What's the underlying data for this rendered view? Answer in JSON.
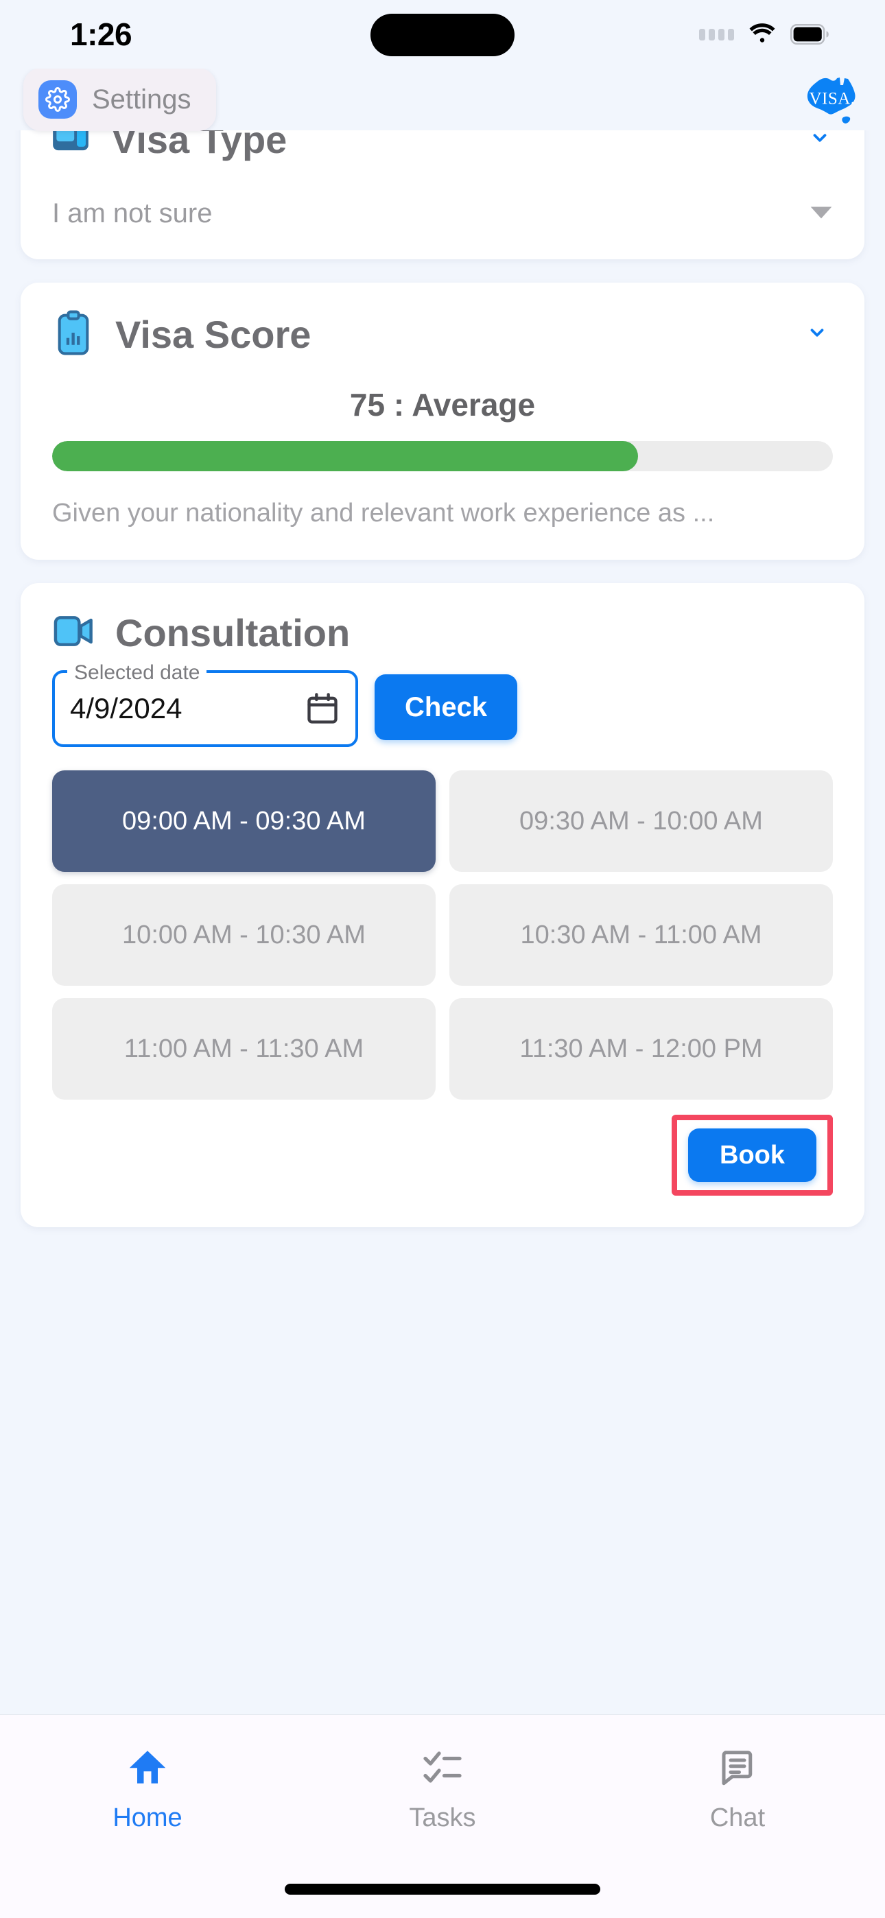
{
  "status_bar": {
    "time": "1:26",
    "icons": [
      "signal-dots-icon",
      "wifi-icon",
      "battery-icon"
    ]
  },
  "header": {
    "settings_label": "Settings",
    "settings_icon": "gear-icon",
    "logo_text": "VISA.",
    "logo_name": "australia-visa-logo"
  },
  "visa_type_card": {
    "title": "Visa Type",
    "icon": "id-card-icon",
    "selected_value": "I am not sure",
    "dropdown_icon": "triangle-down-icon",
    "collapse_icon": "chevron-down-icon"
  },
  "visa_score_card": {
    "title": "Visa Score",
    "icon": "clipboard-chart-icon",
    "collapse_icon": "chevron-down-icon",
    "score_text": "75 : Average",
    "score_value": 75,
    "progress_percent": 75,
    "progress_color": "#4caf50",
    "description": "Given your nationality and relevant work experience as ..."
  },
  "consultation_card": {
    "title": "Consultation",
    "icon": "video-camera-icon",
    "date_field": {
      "label": "Selected date",
      "value": "4/9/2024",
      "icon": "calendar-icon"
    },
    "check_label": "Check",
    "slots": [
      {
        "label": "09:00 AM - 09:30 AM",
        "selected": true
      },
      {
        "label": "09:30 AM - 10:00 AM",
        "selected": false
      },
      {
        "label": "10:00 AM - 10:30 AM",
        "selected": false
      },
      {
        "label": "10:30 AM - 11:00 AM",
        "selected": false
      },
      {
        "label": "11:00 AM - 11:30 AM",
        "selected": false
      },
      {
        "label": "11:30 AM - 12:00 PM",
        "selected": false
      }
    ],
    "book_label": "Book",
    "book_highlight_color": "#f4465f"
  },
  "bottom_nav": {
    "items": [
      {
        "label": "Home",
        "icon": "home-icon",
        "active": true
      },
      {
        "label": "Tasks",
        "icon": "checklist-icon",
        "active": false
      },
      {
        "label": "Chat",
        "icon": "chat-bubble-icon",
        "active": false
      }
    ]
  },
  "colors": {
    "accent_blue": "#0b79f0",
    "page_background": "#f2f6fd",
    "selected_slot": "#4d5f84",
    "highlight_red": "#f4465f"
  }
}
